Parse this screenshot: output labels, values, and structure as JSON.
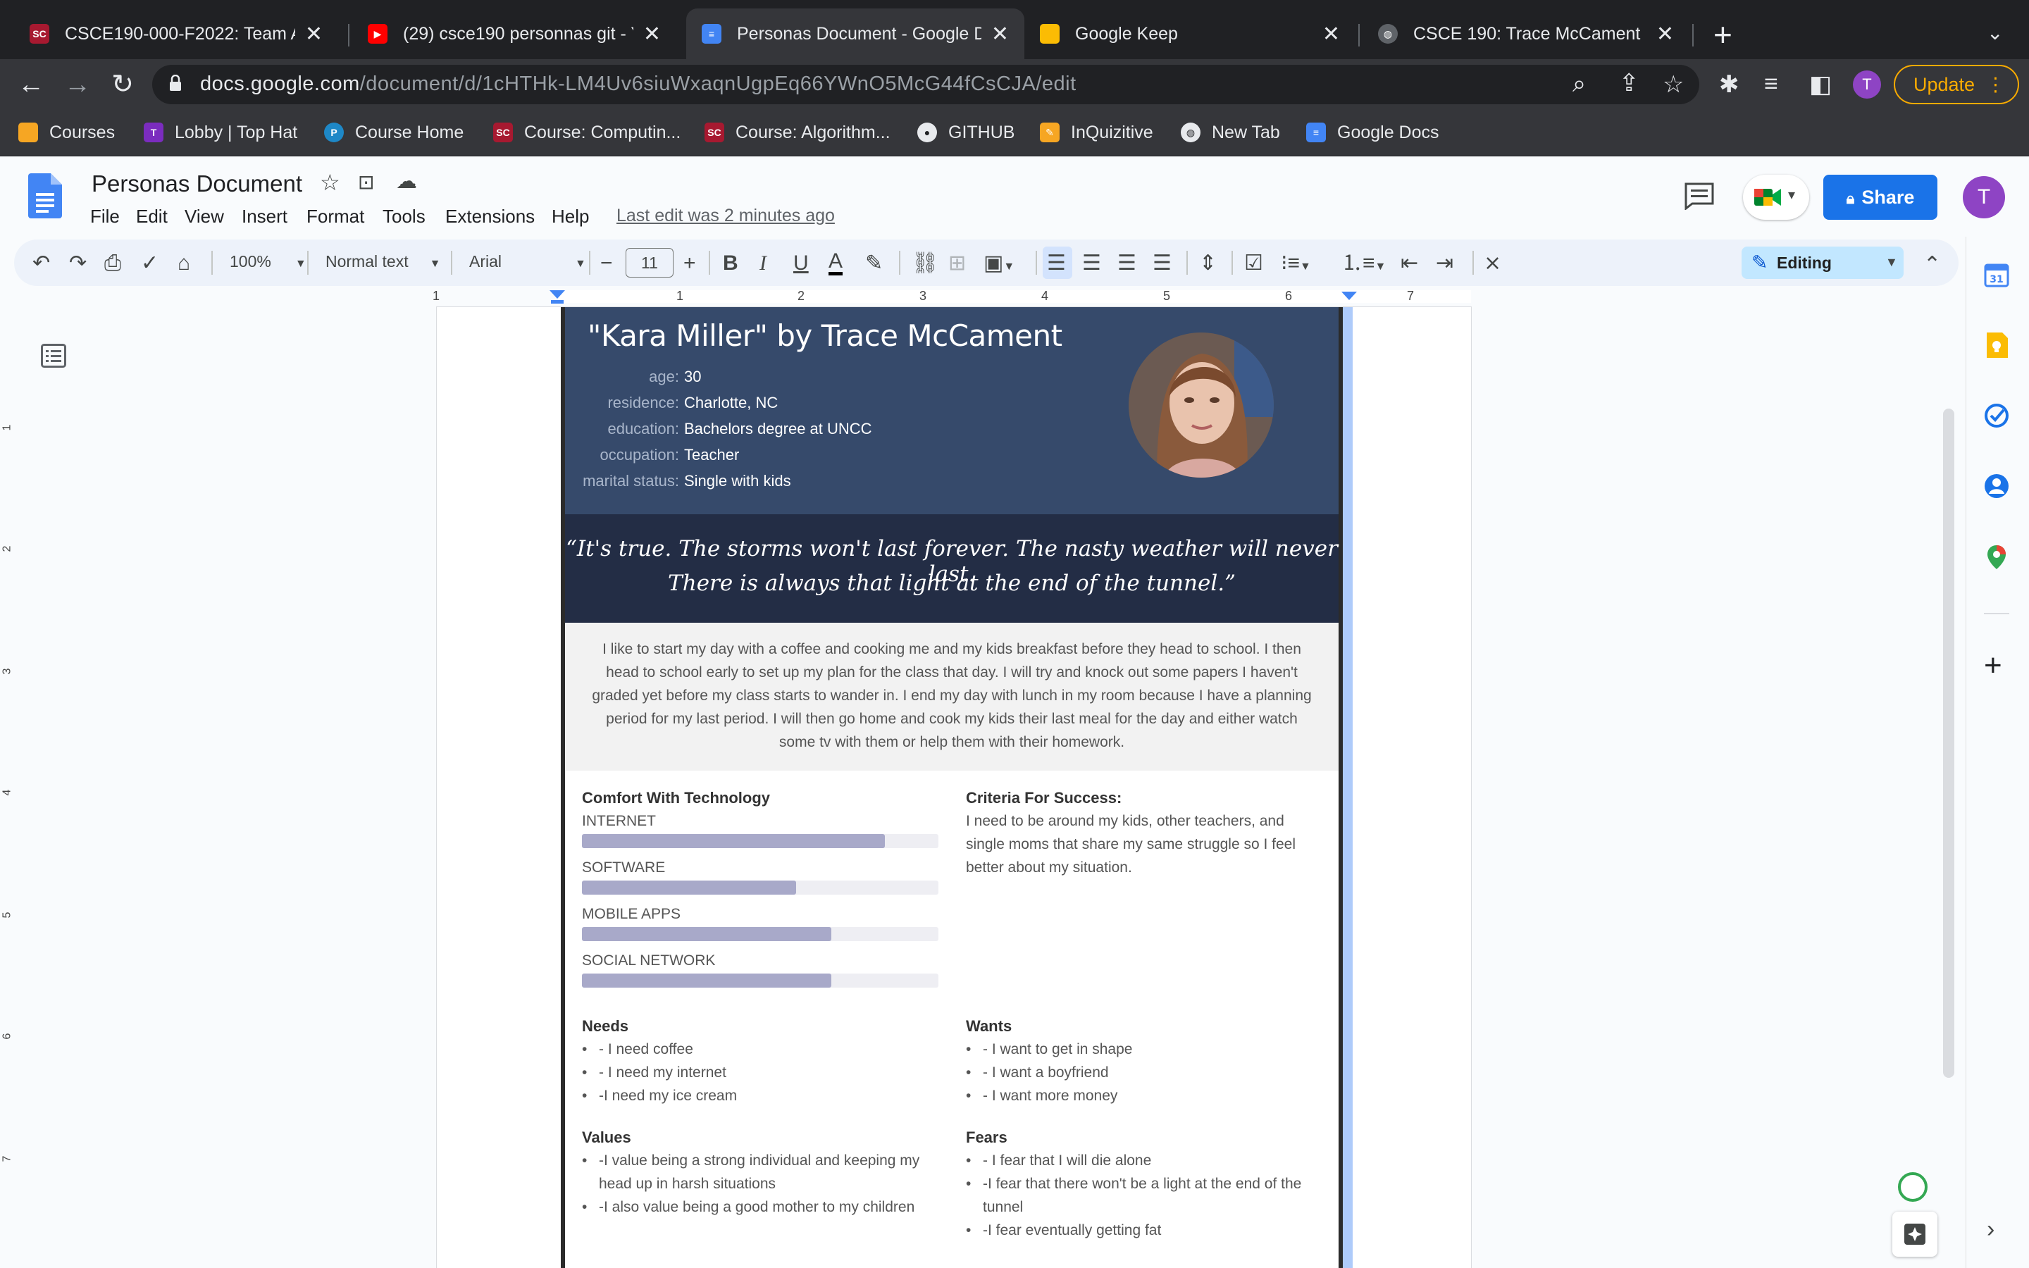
{
  "browser": {
    "tabs": [
      {
        "title": "CSCE190-000-F2022: Team A",
        "favicon_color": "#a71930",
        "favicon": "usc-icon"
      },
      {
        "title": "(29) csce190 personnas git - Y",
        "favicon_color": "#ff0000",
        "favicon": "youtube-icon"
      },
      {
        "title": "Personas Document - Google D",
        "favicon_color": "#4285f4",
        "favicon": "docs-icon"
      },
      {
        "title": "Google Keep",
        "favicon_color": "#fbbc04",
        "favicon": "keep-icon"
      },
      {
        "title": "CSCE 190: Trace McCament",
        "favicon_color": "#9aa0a6",
        "favicon": "globe-icon"
      }
    ],
    "url_host": "docs.google.com",
    "url_path": "/document/d/1cHTHk-LM4Uv6siuWxaqnUgpEq66YWnO5McG44fCsCJA/edit",
    "profile_initial": "T",
    "update_label": "Update",
    "bookmarks": [
      {
        "label": "Courses",
        "icon": "folder-icon"
      },
      {
        "label": "Lobby | Top Hat",
        "icon": "tophat-icon"
      },
      {
        "label": "Course Home",
        "icon": "p-icon"
      },
      {
        "label": "Course: Computin...",
        "icon": "usc-icon"
      },
      {
        "label": "Course: Algorithm...",
        "icon": "usc-icon"
      },
      {
        "label": "GITHUB",
        "icon": "github-icon"
      },
      {
        "label": "InQuizitive",
        "icon": "pencil-icon"
      },
      {
        "label": "New Tab",
        "icon": "globe-icon"
      },
      {
        "label": "Google Docs",
        "icon": "docs-icon"
      }
    ]
  },
  "docs": {
    "title": "Personas Document",
    "menu": [
      "File",
      "Edit",
      "View",
      "Insert",
      "Format",
      "Tools",
      "Extensions",
      "Help"
    ],
    "last_edit": "Last edit was 2 minutes ago",
    "share_label": "Share",
    "avatar_initial": "T",
    "toolbar": {
      "zoom": "100%",
      "style": "Normal text",
      "font": "Arial",
      "font_size": "11",
      "mode": "Editing"
    },
    "ruler_marks": [
      "1",
      "1",
      "2",
      "3",
      "4",
      "5",
      "6",
      "7"
    ],
    "vruler_marks": [
      "1",
      "2",
      "3",
      "4",
      "5",
      "6",
      "7"
    ]
  },
  "persona": {
    "title": "\"Kara Miller\" by Trace McCament",
    "fields": [
      {
        "key": "age:",
        "value": "30"
      },
      {
        "key": "residence:",
        "value": "Charlotte, NC"
      },
      {
        "key": "education:",
        "value": "Bachelors degree at UNCC"
      },
      {
        "key": "occupation:",
        "value": "Teacher"
      },
      {
        "key": "marital status:",
        "value": "Single with kids"
      }
    ],
    "quote_lines": [
      "“It's true. The storms won't last forever. The nasty weather will never last.",
      "There is always that light at the end of the tunnel.”"
    ],
    "bio_lines": [
      "I like to start my day with a coffee and cooking me and my kids breakfast before they head to school. I then",
      "head to school early to set up my plan for the class that day. I will try and knock out some papers I haven't",
      "graded yet before my class starts to wander in. I end my day with lunch in my room because I have a planning",
      "period for my last period. I will then go home and cook my kids their last meal for the day and either watch",
      "some tv with them or help them with their homework."
    ],
    "comfort_title": "Comfort With Technology",
    "comfort": [
      {
        "label": "INTERNET",
        "level": 0.85
      },
      {
        "label": "SOFTWARE",
        "level": 0.6
      },
      {
        "label": "MOBILE APPS",
        "level": 0.7
      },
      {
        "label": "SOCIAL NETWORK",
        "level": 0.7
      }
    ],
    "criteria_title": "Criteria For Success:",
    "criteria_lines": [
      "I need to be around my kids, other teachers, and",
      "single moms that share my same struggle so I feel",
      "better about my situation."
    ],
    "needs_title": "Needs",
    "needs": [
      "- I need coffee",
      "- I need my internet",
      "-I need my ice cream"
    ],
    "wants_title": "Wants",
    "wants": [
      "- I want to get in shape",
      "- I want a boyfriend",
      "- I want more money"
    ],
    "values_title": "Values",
    "values": [
      "-I value being a strong individual and keeping my",
      "head up in harsh situations",
      "-I also value being a good mother to my children"
    ],
    "fears_title": "Fears",
    "fears": [
      "- I fear that I will die alone",
      "-I fear that there won't be a light at the end of the",
      "tunnel",
      "-I fear eventually getting fat"
    ]
  }
}
